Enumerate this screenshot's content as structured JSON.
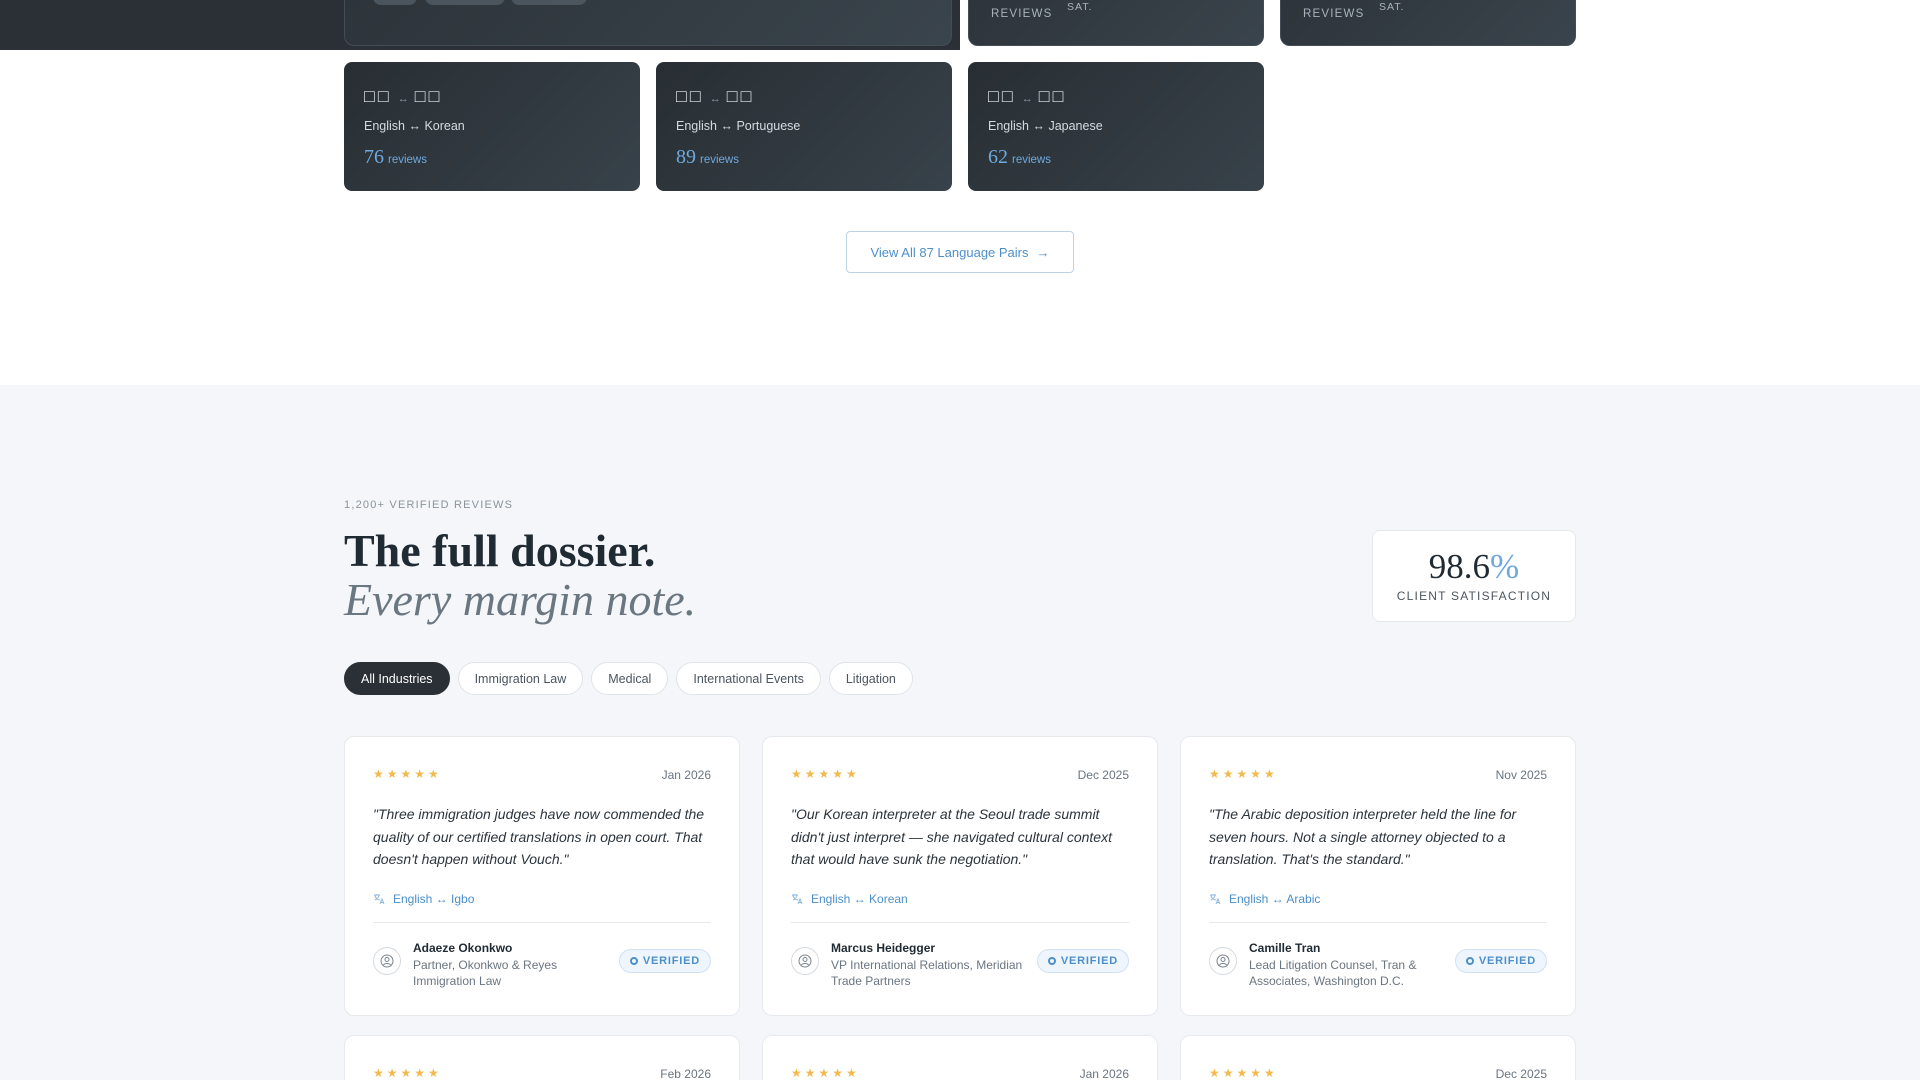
{
  "top_stats": [
    {
      "label": "REVIEWS",
      "sub": "SAT."
    },
    {
      "label": "REVIEWS",
      "sub": "SAT."
    }
  ],
  "language_pairs": [
    {
      "glyph": "□□",
      "glyph2": "□□",
      "arrow": "↔",
      "name": "English ↔ Korean",
      "count": "76",
      "count_label": "reviews"
    },
    {
      "glyph": "□□",
      "glyph2": "□□",
      "arrow": "↔",
      "name": "English ↔ Portuguese",
      "count": "89",
      "count_label": "reviews"
    },
    {
      "glyph": "□□",
      "glyph2": "□□",
      "arrow": "↔",
      "name": "English ↔ Japanese",
      "count": "62",
      "count_label": "reviews"
    }
  ],
  "view_all": {
    "label": "View All 87 Language Pairs",
    "arrow": "→"
  },
  "reviews_section": {
    "eyebrow": "1,200+ VERIFIED REVIEWS",
    "headline": "The full dossier.",
    "headline_italic": "Every margin note.",
    "satisfaction": {
      "value": "98.6",
      "unit": "%",
      "label": "CLIENT SATISFACTION"
    },
    "filters": [
      "All Industries",
      "Immigration Law",
      "Medical",
      "International Events",
      "Litigation"
    ],
    "active_filter": "All Industries",
    "reviews": [
      {
        "stars": "★★★★★",
        "date": "Jan 2026",
        "quote": "\"Three immigration judges have now commended the quality of our certified translations in open court. That doesn't happen without Vouch.\"",
        "language": "English ↔ Igbo",
        "name": "Adaeze Okonkwo",
        "role": "Partner, Okonkwo & Reyes Immigration Law",
        "badge": "VERIFIED"
      },
      {
        "stars": "★★★★★",
        "date": "Dec 2025",
        "quote": "\"Our Korean interpreter at the Seoul trade summit didn't just interpret — she navigated cultural context that would have sunk the negotiation.\"",
        "language": "English ↔ Korean",
        "name": "Marcus Heidegger",
        "role": "VP International Relations, Meridian Trade Partners",
        "badge": "VERIFIED"
      },
      {
        "stars": "★★★★★",
        "date": "Nov 2025",
        "quote": "\"The Arabic deposition interpreter held the line for seven hours. Not a single attorney objected to a translation. That's the standard.\"",
        "language": "English ↔ Arabic",
        "name": "Camille Tran",
        "role": "Lead Litigation Counsel, Tran & Associates, Washington D.C.",
        "badge": "VERIFIED"
      }
    ],
    "next_row": [
      {
        "stars": "★★★★★",
        "date": "Feb 2026"
      },
      {
        "stars": "★★★★★",
        "date": "Jan 2026"
      },
      {
        "stars": "★★★★★",
        "date": "Dec 2025"
      }
    ]
  },
  "colors": {
    "accent": "#4c8fc9",
    "dark": "#2a3035",
    "star": "#f3b94d",
    "section_bg": "#f4f6f9"
  }
}
